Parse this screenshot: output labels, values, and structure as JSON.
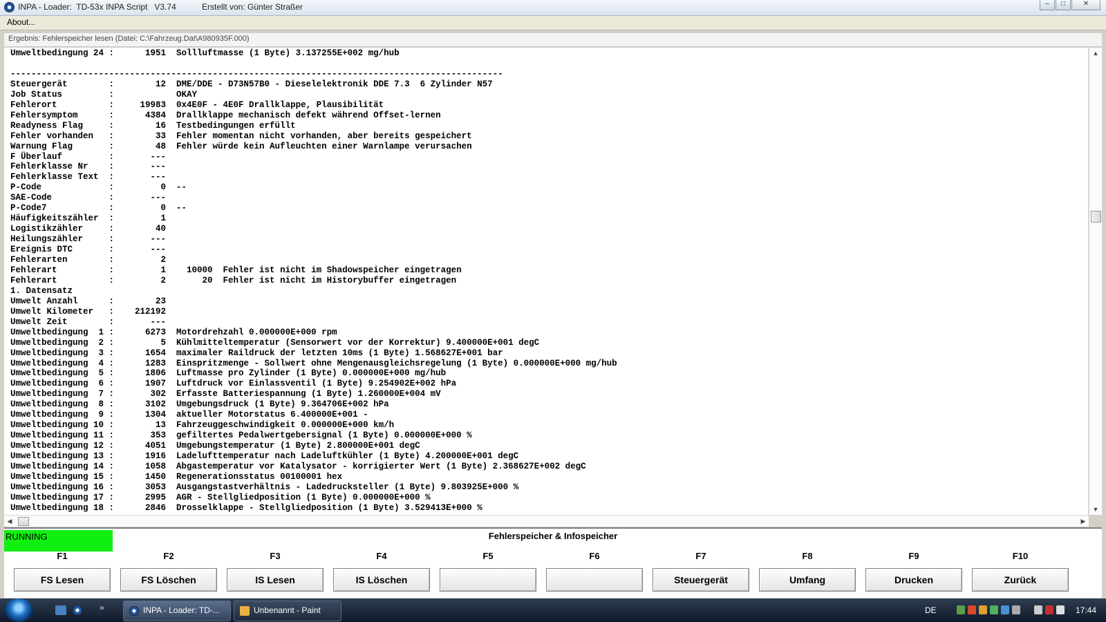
{
  "window": {
    "title": "INPA - Loader:  TD-53x INPA Script   V3.74",
    "author": "Erstellt von: Günter Straßer",
    "menu": [
      "About..."
    ]
  },
  "result_header": "Ergebnis: Fehlerspeicher lesen (Datei: C:\\Fahrzeug.Dat\\A980935F.000)",
  "output_lines": [
    "Umweltbedingung 24 :      1951  Sollluftmasse (1 Byte) 3.137255E+002 mg/hub",
    "",
    "-----------------------------------------------------------------------------------------------",
    "Steuergerät        :        12  DME/DDE - D73N57B0 - Dieselelektronik DDE 7.3  6 Zylinder N57",
    "Job Status         :            OKAY",
    "Fehlerort          :     19983  0x4E0F - 4E0F Drallklappe, Plausibilität",
    "Fehlersymptom      :      4384  Drallklappe mechanisch defekt während Offset-lernen",
    "Readyness Flag     :        16  Testbedingungen erfüllt",
    "Fehler vorhanden   :        33  Fehler momentan nicht vorhanden, aber bereits gespeichert",
    "Warnung Flag       :        48  Fehler würde kein Aufleuchten einer Warnlampe verursachen",
    "F Überlauf         :       ---",
    "Fehlerklasse Nr    :       ---",
    "Fehlerklasse Text  :       ---",
    "P-Code             :         0  --",
    "SAE-Code           :       ---",
    "P-Code7            :         0  --",
    "Häufigkeitszähler  :         1",
    "Logistikzähler     :        40",
    "Heilungszähler     :       ---",
    "Ereignis DTC       :       ---",
    "Fehlerarten        :         2",
    "Fehlerart          :         1    10000  Fehler ist nicht im Shadowspeicher eingetragen",
    "Fehlerart          :         2       20  Fehler ist nicht im Historybuffer eingetragen",
    "1. Datensatz",
    "Umwelt Anzahl      :        23",
    "Umwelt Kilometer   :    212192",
    "Umwelt Zeit        :       ---",
    "Umweltbedingung  1 :      6273  Motordrehzahl 0.000000E+000 rpm",
    "Umweltbedingung  2 :         5  Kühlmitteltemperatur (Sensorwert vor der Korrektur) 9.400000E+001 degC",
    "Umweltbedingung  3 :      1654  maximaler Raildruck der letzten 10ms (1 Byte) 1.568627E+001 bar",
    "Umweltbedingung  4 :      1283  Einspritzmenge - Sollwert ohne Mengenausgleichsregelung (1 Byte) 0.000000E+000 mg/hub",
    "Umweltbedingung  5 :      1806  Luftmasse pro Zylinder (1 Byte) 0.000000E+000 mg/hub",
    "Umweltbedingung  6 :      1907  Luftdruck vor Einlassventil (1 Byte) 9.254902E+002 hPa",
    "Umweltbedingung  7 :       302  Erfasste Batteriespannung (1 Byte) 1.260000E+004 mV",
    "Umweltbedingung  8 :      3102  Umgebungsdruck (1 Byte) 9.364706E+002 hPa",
    "Umweltbedingung  9 :      1304  aktueller Motorstatus 6.400000E+001 -",
    "Umweltbedingung 10 :        13  Fahrzeuggeschwindigkeit 0.000000E+000 km/h",
    "Umweltbedingung 11 :       353  gefiltertes Pedalwertgebersignal (1 Byte) 0.000000E+000 %",
    "Umweltbedingung 12 :      4051  Umgebungstemperatur (1 Byte) 2.800000E+001 degC",
    "Umweltbedingung 13 :      1916  Ladelufttemperatur nach Ladeluftkühler (1 Byte) 4.200000E+001 degC",
    "Umweltbedingung 14 :      1058  Abgastemperatur vor Katalysator - korrigierter Wert (1 Byte) 2.368627E+002 degC",
    "Umweltbedingung 15 :      1450  Regenerationsstatus 00100001 hex",
    "Umweltbedingung 16 :      3053  Ausgangstastverhältnis - Ladedrucksteller (1 Byte) 9.803925E+000 %",
    "Umweltbedingung 17 :      2995  AGR - Stellgliedposition (1 Byte) 0.000000E+000 %",
    "Umweltbedingung 18 :      2846  Drosselklappe - Stellgliedposition (1 Byte) 3.529413E+000 %"
  ],
  "status": {
    "text": "RUNNING",
    "color": "#10f010"
  },
  "panel_title": "Fehlerspeicher & Infospeicher",
  "function_keys": [
    {
      "key": "F1",
      "label": "FS Lesen"
    },
    {
      "key": "F2",
      "label": "FS Löschen"
    },
    {
      "key": "F3",
      "label": "IS Lesen"
    },
    {
      "key": "F4",
      "label": "IS Löschen"
    },
    {
      "key": "F5",
      "label": ""
    },
    {
      "key": "F6",
      "label": ""
    },
    {
      "key": "F7",
      "label": "Steuergerät"
    },
    {
      "key": "F8",
      "label": "Umfang"
    },
    {
      "key": "F9",
      "label": "Drucken"
    },
    {
      "key": "F10",
      "label": "Zurück"
    }
  ],
  "taskbar": {
    "tasks": [
      "INPA - Loader:  TD-...",
      "Unbenannt - Paint"
    ],
    "language": "DE",
    "clock": "17:44"
  }
}
